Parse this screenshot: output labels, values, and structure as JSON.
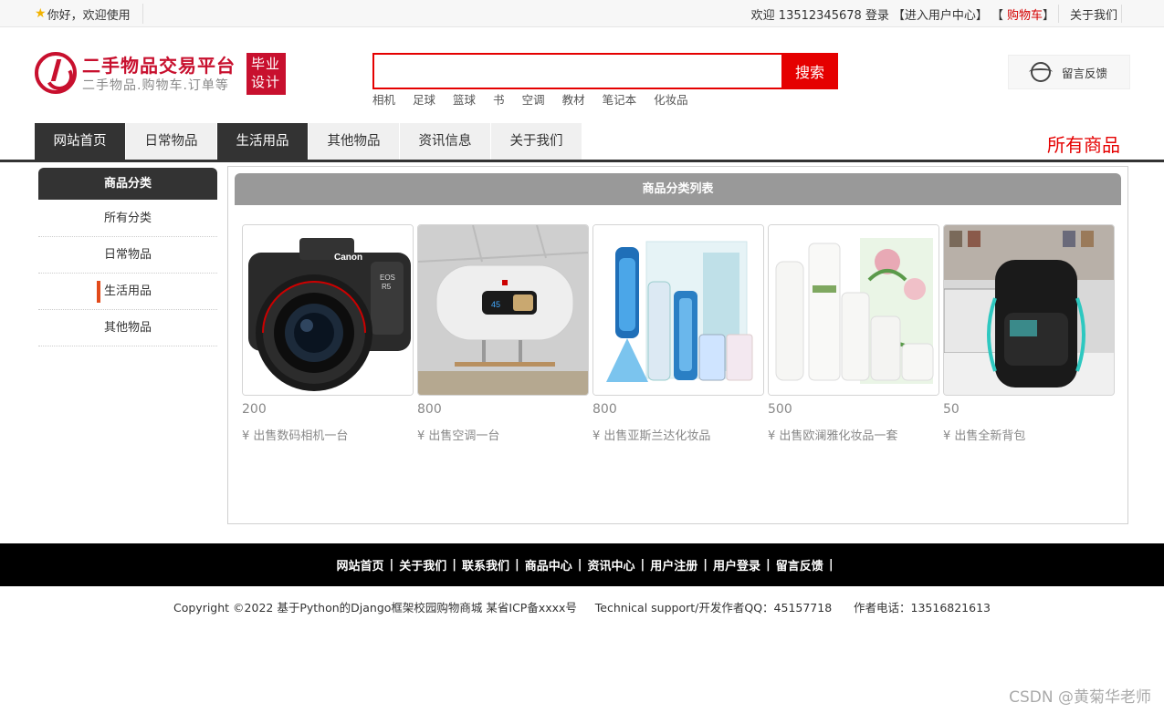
{
  "topbar": {
    "greeting": "你好，欢迎使用",
    "welcome": "欢迎 13512345678 登录",
    "user_center": "【进入用户中心】",
    "cart": "购物车",
    "about": "关于我们"
  },
  "header": {
    "logo_title": "二手物品交易平台",
    "logo_sub": "二手物品.购物车.订单等",
    "logo_badge_1": "毕业",
    "logo_badge_2": "设计",
    "search_value": "",
    "search_button": "搜索",
    "hotwords": [
      "相机",
      "足球",
      "篮球",
      "书",
      "空调",
      "教材",
      "笔记本",
      "化妆品"
    ],
    "feedback": "留言反馈"
  },
  "nav": {
    "items": [
      "网站首页",
      "日常物品",
      "生活用品",
      "其他物品",
      "资讯信息",
      "关于我们"
    ],
    "all_goods": "所有商品"
  },
  "sidebar": {
    "title": "商品分类",
    "items": [
      "所有分类",
      "日常物品",
      "生活用品",
      "其他物品"
    ]
  },
  "main": {
    "title": "商品分类列表",
    "products": [
      {
        "price": "200",
        "name": "¥ 出售数码相机一台",
        "image": "camera"
      },
      {
        "price": "800",
        "name": "¥ 出售空调一台",
        "image": "water-heater"
      },
      {
        "price": "800",
        "name": "¥ 出售亚斯兰达化妆品",
        "image": "cosmetics-blue"
      },
      {
        "price": "500",
        "name": "¥ 出售欧澜雅化妆品一套",
        "image": "cosmetics-white"
      },
      {
        "price": "50",
        "name": "¥ 出售全新背包",
        "image": "backpack"
      }
    ]
  },
  "footer": {
    "links": [
      "网站首页",
      "关于我们",
      "联系我们",
      "商品中心",
      "资讯中心",
      "用户注册",
      "用户登录",
      "留言反馈"
    ],
    "copyright": "Copyright ©2022 基于Python的Django框架校园购物商城 某省ICP备xxxx号     Technical support/开发作者QQ：45157718      作者电话：13516821613"
  },
  "watermark": "CSDN @黄菊华老师"
}
